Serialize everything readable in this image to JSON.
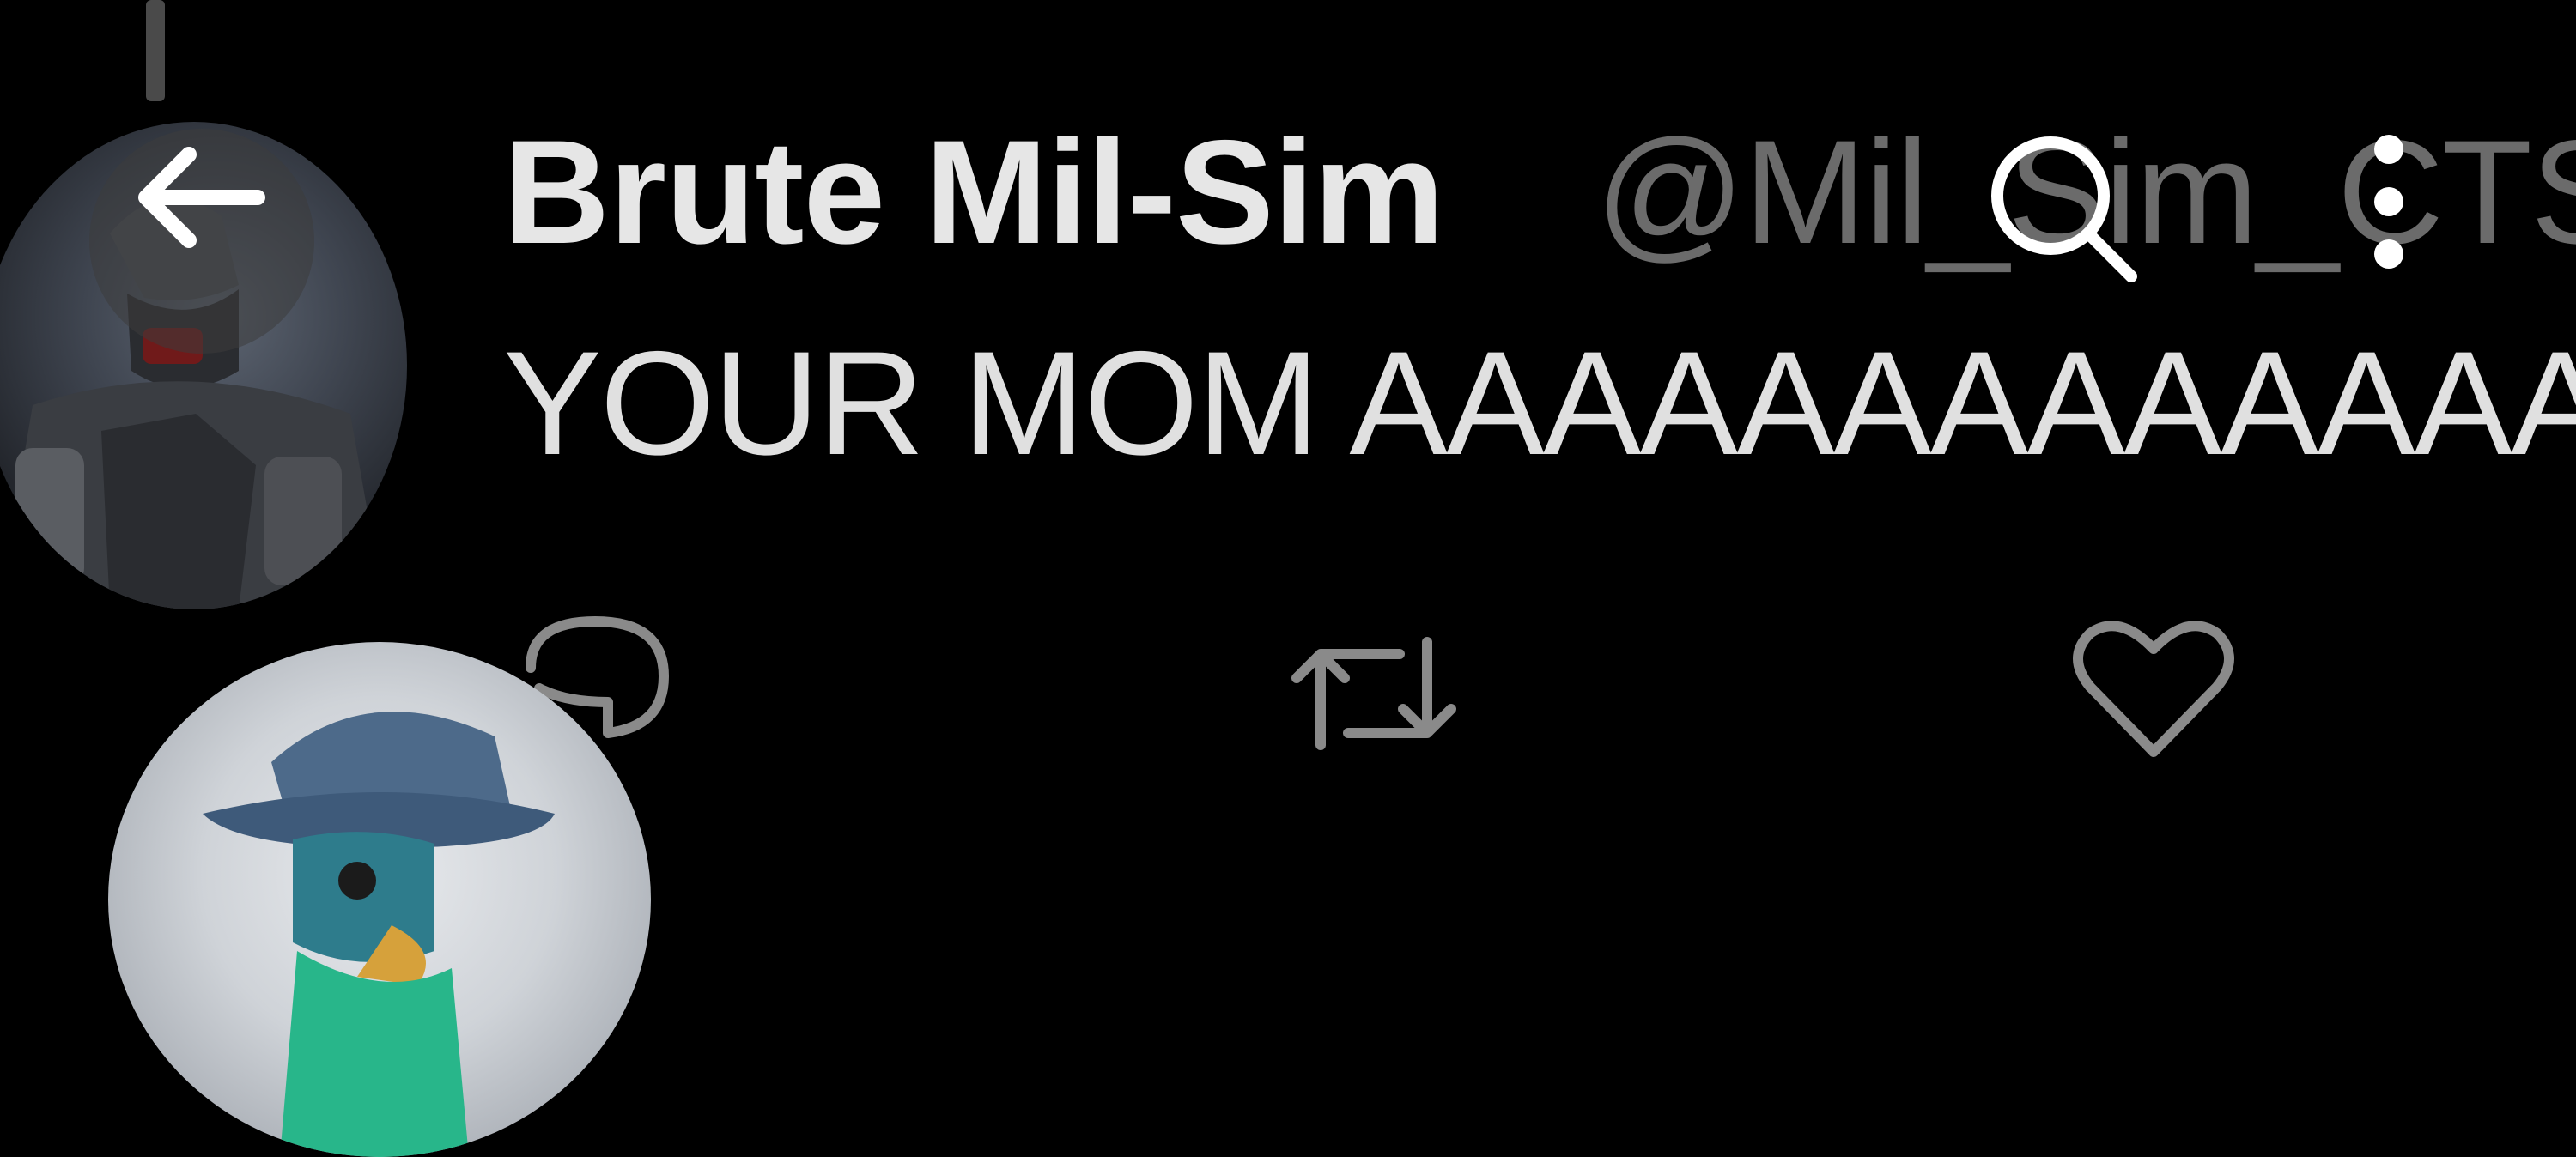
{
  "tweet": {
    "author_name": "Brute Mil-Sim",
    "author_handle": "@Mil_Sim_CTS",
    "text": "YOUR MOM AAAAAAAAAAAAA"
  },
  "header": {
    "back_icon": "arrow-left-icon",
    "search_icon": "search-icon",
    "more_icon": "more-vertical-icon"
  },
  "actions": [
    {
      "name": "reply",
      "icon": "reply-icon"
    },
    {
      "name": "retweet",
      "icon": "retweet-icon"
    },
    {
      "name": "like",
      "icon": "heart-icon"
    }
  ],
  "colors": {
    "background": "#000000",
    "name_text": "#e6e6e6",
    "handle_text": "#6b6b6b",
    "icon_gray": "#8a8a8a"
  }
}
